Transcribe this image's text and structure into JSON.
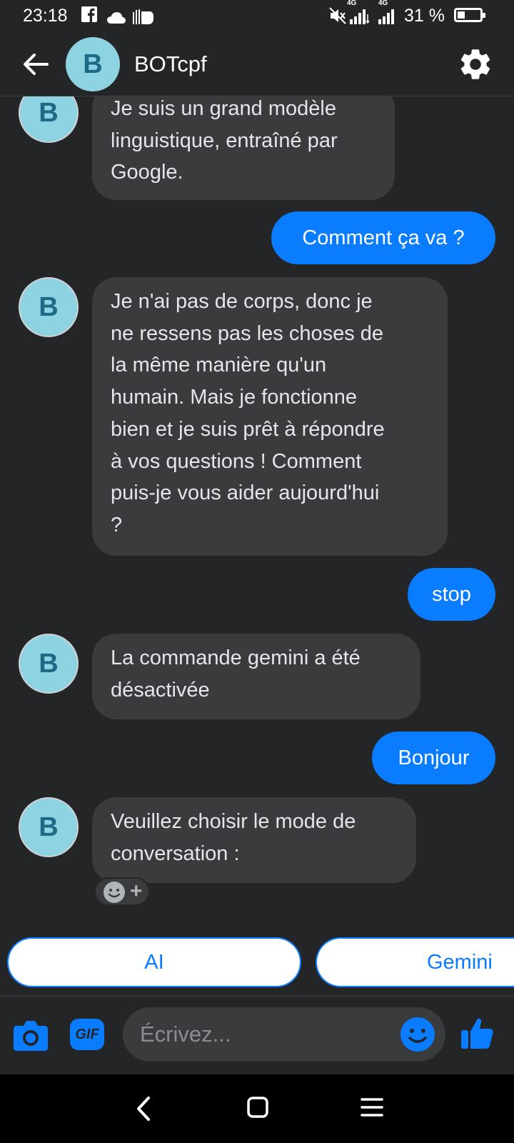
{
  "status_bar": {
    "time": "23:18",
    "network_left": "4G",
    "network_right": "4G",
    "battery_percent": "31 %",
    "battery_level": 0.31,
    "icons": [
      "facebook-icon",
      "cloud-icon",
      "hand-icon",
      "mute-icon",
      "signal-icon",
      "signal-icon",
      "battery-icon"
    ]
  },
  "header": {
    "avatar_letter": "B",
    "title": "BOTcpf",
    "icons": [
      "back-arrow-icon",
      "gear-icon"
    ]
  },
  "messages": [
    {
      "from": "bot",
      "avatar_letter": "B",
      "lines": [
        "Je suis un grand modèle",
        "linguistique, entraîné par",
        "Google."
      ]
    },
    {
      "from": "user",
      "text": "Comment ça va ?"
    },
    {
      "from": "bot",
      "avatar_letter": "B",
      "lines": [
        "Je n'ai pas de corps, donc je",
        "ne ressens pas les choses de",
        "la même manière qu'un",
        "humain. Mais je fonctionne",
        "bien et je suis prêt à répondre",
        "à vos questions ! Comment",
        "puis-je vous aider aujourd'hui",
        "?"
      ]
    },
    {
      "from": "user",
      "text": "stop"
    },
    {
      "from": "bot",
      "avatar_letter": "B",
      "lines": [
        "La commande gemini a été",
        "désactivée"
      ]
    },
    {
      "from": "user",
      "text": "Bonjour"
    },
    {
      "from": "bot",
      "avatar_letter": "B",
      "lines": [
        "Veuillez choisir le mode de",
        "conversation :"
      ]
    }
  ],
  "reaction": {
    "icon": "add-reaction-icon",
    "plus": "+"
  },
  "quick_replies": [
    {
      "label": "AI"
    },
    {
      "label": "Gemini"
    }
  ],
  "composer": {
    "placeholder": "Écrivez...",
    "gif_label": "GIF",
    "icons": [
      "camera-icon",
      "gif-icon",
      "emoji-icon",
      "thumbs-up-icon"
    ]
  },
  "nav_bar": {
    "icons": [
      "back-nav-icon",
      "home-nav-icon",
      "menu-nav-icon"
    ]
  },
  "colors": {
    "background": "#242526",
    "bot_bubble": "#3a3b3c",
    "user_bubble": "#0a7cff",
    "accent": "#0a7cff",
    "avatar": "#8dd3e2",
    "avatar_letter": "#1e6a86"
  }
}
